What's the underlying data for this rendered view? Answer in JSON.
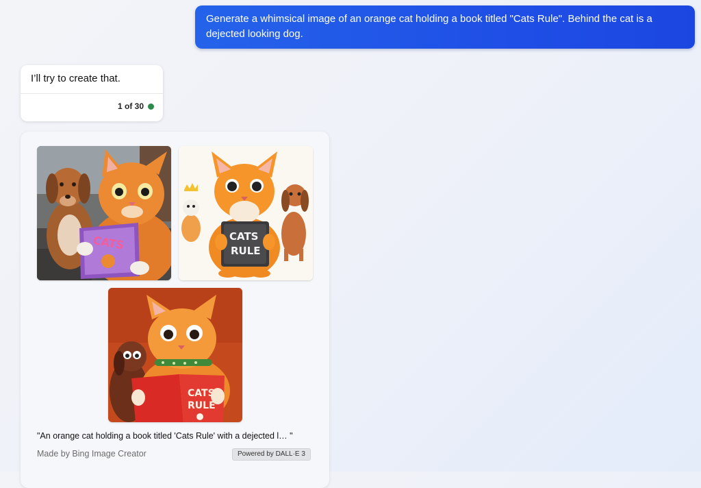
{
  "user_message": {
    "text": "Generate a whimsical image of an orange cat holding a book titled \"Cats Rule\".  Behind the cat is a dejected looking dog."
  },
  "bot_reply": {
    "text": "I’ll try to create that.",
    "counter": "1 of 30",
    "status_color": "#2c8a4b"
  },
  "image_result": {
    "images": [
      {
        "name": "image-1",
        "book_text": [
          "CATS",
          "RULE"
        ]
      },
      {
        "name": "image-2",
        "book_text": [
          "CATS",
          "RULE"
        ]
      },
      {
        "name": "image-3",
        "book_text": [
          "CATS",
          "RULE"
        ]
      }
    ],
    "caption": "\"An orange cat holding a book titled 'Cats Rule' with a dejected l…  \"",
    "made_by": "Made by Bing Image Creator",
    "powered_by": "Powered by DALL·E 3"
  },
  "colors": {
    "user_bubble": "#1f4fe6",
    "card_background": "#ffffff",
    "page_background": "#eef1f8"
  }
}
